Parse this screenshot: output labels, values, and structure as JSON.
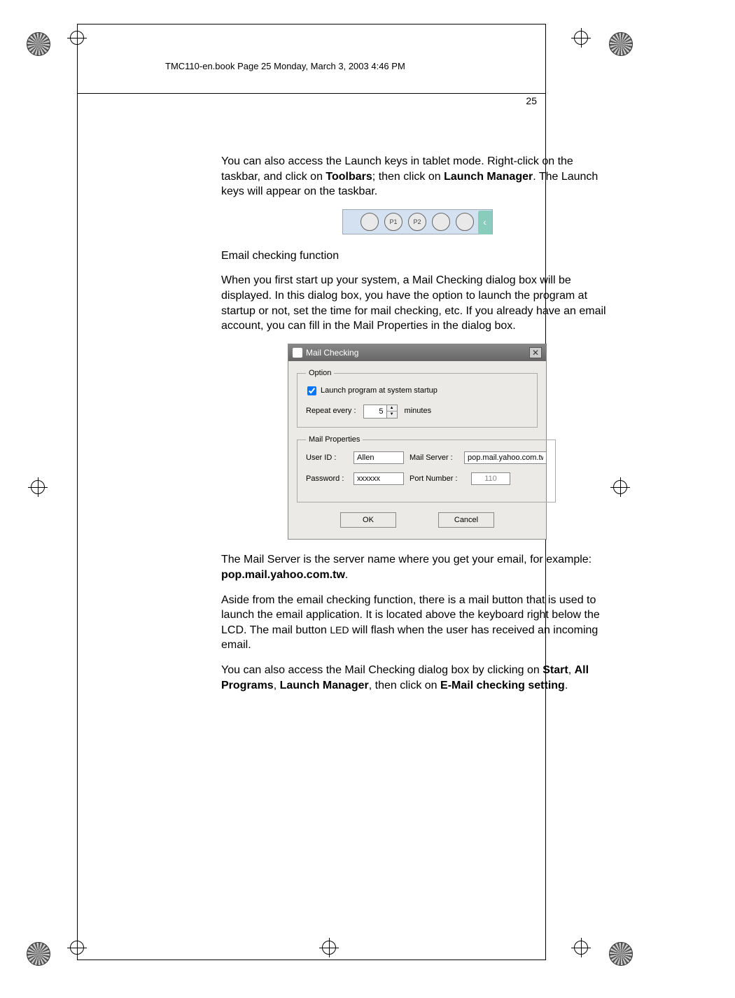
{
  "cropText": "TMC110-en.book  Page 25  Monday, March 3, 2003  4:46 PM",
  "pageNumber": "25",
  "para1": {
    "pre": "You can also access the Launch keys in tablet mode.  Right-click on the taskbar, and click on ",
    "b1": "Toolbars",
    "mid": "; then click on ",
    "b2": "Launch Manager",
    "post": ".  The Launch keys will appear on the taskbar."
  },
  "toolbar": {
    "buttons": [
      "",
      "P1",
      "P2",
      "",
      ""
    ],
    "chevron": "‹"
  },
  "heading1": "Email checking function",
  "para2": "When you first start up your system, a Mail Checking dialog box will be displayed.  In this dialog box, you have the option to launch the program at startup or not, set the time for mail checking, etc.  If you already have an email account, you can fill in the Mail Properties in the dialog box.",
  "dialog": {
    "title": "Mail Checking",
    "optionLegend": "Option",
    "checkLabel": "Launch program at system startup",
    "repeatLabel": "Repeat every :",
    "repeatValue": "5",
    "repeatUnit": "minutes",
    "propsLegend": "Mail Properties",
    "userIdLabel": "User ID :",
    "userIdValue": "Allen",
    "mailServerLabel": "Mail Server :",
    "mailServerValue": "pop.mail.yahoo.com.tw",
    "passwordLabel": "Password :",
    "passwordValue": "xxxxxx",
    "portLabel": "Port Number :",
    "portValue": "110",
    "okLabel": "OK",
    "cancelLabel": "Cancel",
    "closeGlyph": "✕"
  },
  "para3": {
    "pre": "The Mail Server is the server name where you get your email, for example: ",
    "b1": "pop.mail.yahoo.com.tw",
    "post": "."
  },
  "para4": {
    "pre": "Aside from the email checking function, there is a mail button that is used to launch the email application.  It is located above the keyboard right below the LCD.  The mail button ",
    "led": "LED",
    "post": " will flash when the user has received an incoming email."
  },
  "para5": {
    "pre": "You can also access the Mail Checking dialog box by clicking on ",
    "b1": "Start",
    "c1": ", ",
    "b2": "All Programs",
    "c2": ", ",
    "b3": "Launch Manager",
    "mid": ", then click on ",
    "b4": "E-Mail checking setting",
    "post": "."
  }
}
